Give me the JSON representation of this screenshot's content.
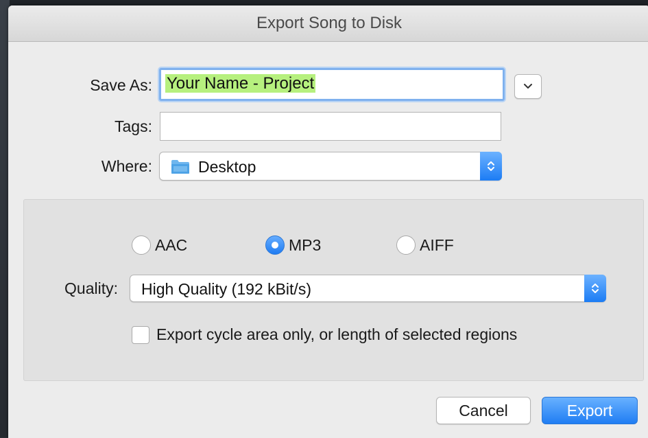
{
  "window": {
    "title": "Export Song to Disk"
  },
  "form": {
    "save_as_label": "Save As:",
    "save_as_value": "Your Name - Project",
    "tags_label": "Tags:",
    "tags_value": "",
    "where_label": "Where:",
    "where_value": "Desktop"
  },
  "format": {
    "options": [
      {
        "label": "AAC",
        "selected": false
      },
      {
        "label": "MP3",
        "selected": true
      },
      {
        "label": "AIFF",
        "selected": false
      }
    ],
    "quality_label": "Quality:",
    "quality_value": "High Quality (192 kBit/s)",
    "cycle_checkbox_label": "Export cycle area only, or length of selected regions",
    "cycle_checked": false
  },
  "buttons": {
    "cancel": "Cancel",
    "export": "Export"
  },
  "colors": {
    "accent": "#1f7df3",
    "selection_highlight": "#b6f07e",
    "dialog_bg": "#ececec"
  },
  "icons": {
    "disclosure": "chevron-down-icon",
    "stepper": "up-down-stepper-icon",
    "folder": "folder-icon"
  }
}
